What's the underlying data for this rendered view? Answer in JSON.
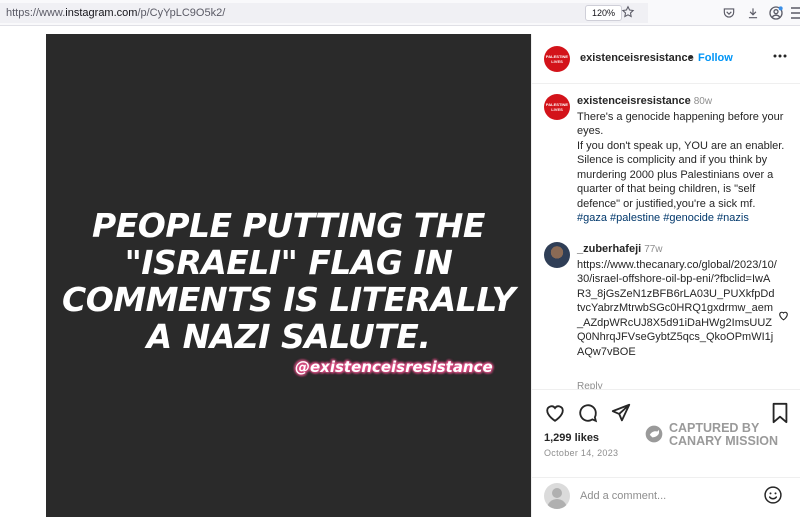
{
  "browser": {
    "url_prefix": "https://www.",
    "url_host": "instagram.com",
    "url_path": "/p/CyYpLC9O5k2/",
    "zoom": "120%"
  },
  "post": {
    "headline_lines": [
      "PEOPLE PUTTING THE",
      "\"ISRAELI\" FLAG IN",
      "COMMENTS IS LITERALLY",
      "A NAZI SALUTE."
    ],
    "overlay_handle": "@existenceisresistance"
  },
  "header": {
    "avatar_text": "PALESTINE LIVES",
    "username": "existenceisresistance",
    "separator": "•",
    "follow_label": "Follow",
    "more_label": "•••"
  },
  "caption": {
    "username": "existenceisresistance",
    "time": "80w",
    "lines": [
      "There's a genocide happening before your eyes.",
      "If you don't speak up, YOU are an enabler.",
      "Silence is complicity and if you think by murdering 2000 plus Palestinians over a quarter of that being children, is \"self defence\" or justified,you're a sick mf."
    ],
    "tags": "#gaza #palestine #genocide #nazis"
  },
  "comment": {
    "username": "_zuberhafeji",
    "time": "77w",
    "text": "https://www.thecanary.co/global/2023/10/30/israel-offshore-oil-bp-eni/?fbclid=IwAR3_8jGsZeN1zBFB6rLA03U_PUXkfpDdtvcYabrzMtrwbSGc0HRQ1gxdrmw_aem_AZdpWRcUJ8X5d91iDaHWg2ImsUUZQ0NhrqJFVseGybtZ5qcs_QkoOPmWI1jAQw7vBOE",
    "reply_label": "Reply"
  },
  "actions": {
    "likes": "1,299 likes",
    "date": "October 14, 2023"
  },
  "watermark": {
    "line1": "CAPTURED BY",
    "line2": "CANARY MISSION"
  },
  "add_comment": {
    "placeholder": "Add a comment..."
  },
  "colors": {
    "instagram_blue": "#0095f6",
    "avatar_red": "#d3131a",
    "image_bg": "#2a2a2a",
    "overlay_pink": "#e8508a"
  }
}
